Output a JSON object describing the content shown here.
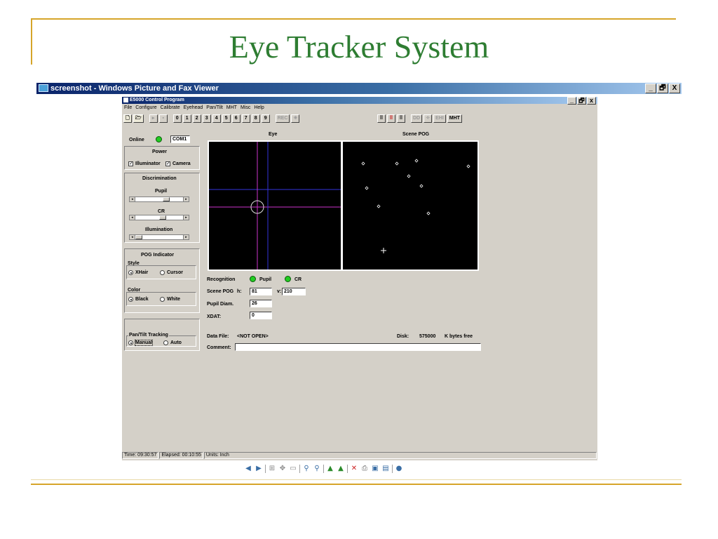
{
  "slide": {
    "title": "Eye Tracker System"
  },
  "viewer": {
    "title": "screenshot - Windows Picture and Fax Viewer",
    "controls": {
      "minimize": "_",
      "restore": "🗗",
      "close": "X"
    },
    "toolbar_icons": [
      "prev-image-icon",
      "next-image-icon",
      "best-fit-icon",
      "actual-size-icon",
      "slideshow-icon",
      "zoom-in-icon",
      "zoom-out-icon",
      "rotate-clockwise-icon",
      "rotate-counterclockwise-icon",
      "delete-icon",
      "print-icon",
      "save-icon",
      "edit-icon",
      "help-icon"
    ]
  },
  "app": {
    "title": "E5000 Control Program",
    "controls": {
      "minimize": "_",
      "restore": "🗗",
      "close": "x"
    },
    "menu": [
      "File",
      "Configure",
      "Calibrate",
      "Eyehead",
      "Pan/Tilt",
      "MHT",
      "Misc",
      "Help"
    ],
    "toolbar_numbers": [
      "0",
      "1",
      "2",
      "3",
      "4",
      "5",
      "6",
      "7",
      "8",
      "9"
    ],
    "toolbar_disabled_label": "REC",
    "toolbar_right": [
      "DD",
      "EHI",
      "MHT"
    ],
    "online": {
      "label": "Online",
      "port": "COM1"
    },
    "power": {
      "title": "Power",
      "illuminator": "Illuminator",
      "camera": "Camera",
      "illuminator_checked": true,
      "camera_checked": true
    },
    "discrimination": {
      "title": "Discrimination",
      "pupil": "Pupil",
      "cr": "CR",
      "illumination": "Illumination",
      "pupil_level": 0.55,
      "cr_level": 0.5,
      "illumination_level": 0.05
    },
    "pog_indicator": {
      "title": "POG Indicator",
      "style_label": "Style",
      "xhair": "XHair",
      "cursor": "Cursor",
      "color_label": "Color",
      "black": "Black",
      "white": "White"
    },
    "pantilt": {
      "title": "Pan/Tilt Tracking",
      "manual": "Manual",
      "auto": "Auto"
    },
    "eye_panel": {
      "title": "Eye"
    },
    "scene_panel": {
      "title": "Scene POG"
    },
    "recognition": {
      "label": "Recognition",
      "pupil": "Pupil",
      "cr": "CR"
    },
    "scene_pog": {
      "label": "Scene POG",
      "h_label": "h:",
      "h": "81",
      "v_label": "v:",
      "v": "210"
    },
    "pupil_diam": {
      "label": "Pupil Diam.",
      "value": "26"
    },
    "xdat": {
      "label": "XDAT:",
      "value": "0"
    },
    "data_file": {
      "label": "Data File:",
      "value": "<NOT OPEN>"
    },
    "disk": {
      "label": "Disk:",
      "value": "575000",
      "unit": "K bytes free"
    },
    "comment": {
      "label": "Comment:",
      "value": ""
    },
    "status": {
      "time": "Time: 09:30:57",
      "elapsed": "Elapsed: 00:10:55",
      "units": "Units: Inch"
    }
  }
}
